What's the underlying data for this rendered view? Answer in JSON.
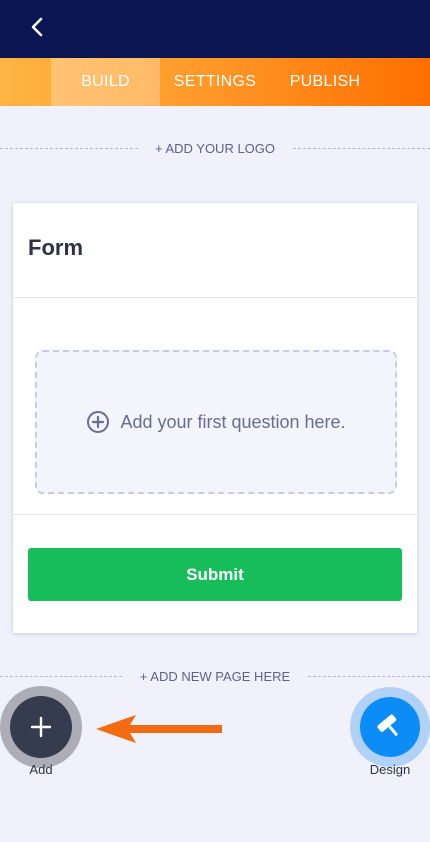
{
  "tabs": [
    {
      "label": "BUILD",
      "active": true
    },
    {
      "label": "SETTINGS",
      "active": false
    },
    {
      "label": "PUBLISH",
      "active": false
    }
  ],
  "header": {
    "back_icon": "chevron-left-icon"
  },
  "builder": {
    "add_logo_label": "+ ADD YOUR LOGO",
    "form_title": "Form",
    "dropzone_label": "Add your first question here.",
    "dropzone_icon": "plus-circle-icon",
    "submit_label": "Submit",
    "add_page_label": "+ ADD NEW PAGE HERE"
  },
  "actions": {
    "add_label": "Add",
    "add_icon": "plus-icon",
    "design_label": "Design",
    "design_icon": "paint-roller-icon"
  },
  "colors": {
    "header_bg": "#0a1551",
    "tab_gradient_start": "#ffb443",
    "tab_gradient_end": "#ff6f00",
    "submit_bg": "#18bd5b",
    "design_fab": "#0b8cf6",
    "add_fab": "#343c4e",
    "arrow": "#f26a12"
  }
}
